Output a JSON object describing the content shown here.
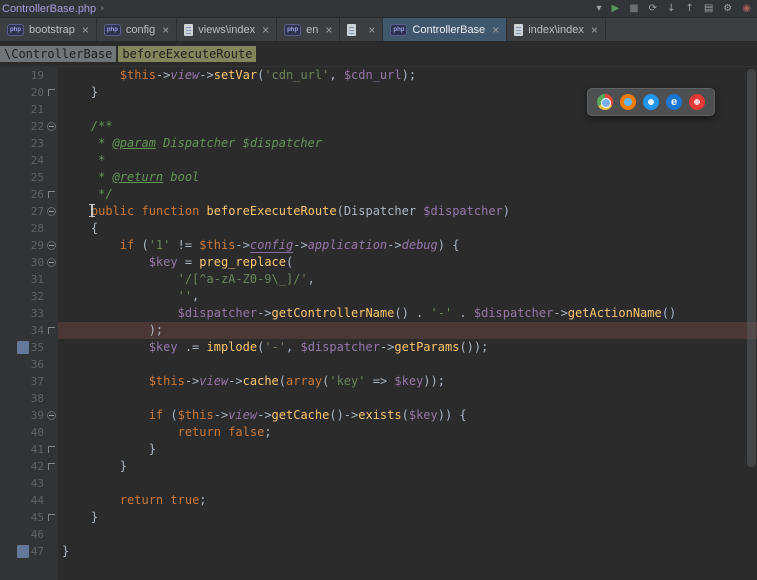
{
  "window": {
    "title": "ControllerBase.php",
    "chevron": "›"
  },
  "toolbar": {
    "icons": [
      {
        "name": "run-config-selector-icon",
        "glyph": "▾",
        "color": "#9da2a6"
      },
      {
        "name": "run-icon",
        "glyph": "▶",
        "color": "#57965c"
      },
      {
        "name": "stop-icon",
        "glyph": "■",
        "color": "#6b6f73"
      },
      {
        "name": "sync-icon",
        "glyph": "⟳",
        "color": "#9da2a6"
      },
      {
        "name": "download-icon",
        "glyph": "↓",
        "color": "#9da2a6"
      },
      {
        "name": "upload-icon",
        "glyph": "↑",
        "color": "#9da2a6"
      },
      {
        "name": "structure-icon",
        "glyph": "▤",
        "color": "#9da2a6"
      },
      {
        "name": "settings-icon",
        "glyph": "⚙",
        "color": "#9da2a6"
      },
      {
        "name": "record-icon",
        "glyph": "◉",
        "color": "#a75d5d"
      }
    ]
  },
  "ui": {
    "close_glyph": "×",
    "php_icon_text": "php"
  },
  "tabs": [
    {
      "label": "bootstrap",
      "icon": "php",
      "selected": false
    },
    {
      "label": "config",
      "icon": "php",
      "selected": false
    },
    {
      "label": "views\\index",
      "icon": "file",
      "selected": false
    },
    {
      "label": "en",
      "icon": "php",
      "selected": false
    },
    {
      "label": "",
      "icon": "file",
      "selected": false
    },
    {
      "label": "ControllerBase",
      "icon": "php",
      "selected": true
    },
    {
      "label": "index\\index",
      "icon": "file",
      "selected": false
    }
  ],
  "breadcrumb": {
    "class_name": "\\ControllerBase",
    "method_name": "beforeExecuteRoute"
  },
  "browser_popup": {
    "browsers": [
      "chrome",
      "firefox",
      "safari",
      "ie",
      "opera"
    ],
    "ie_glyph": "e"
  },
  "colors": {
    "editor_background": "#2b2b2b",
    "gutter_background": "#313335",
    "keyword": "#cc7832",
    "string": "#6a8759",
    "variable": "#9876aa",
    "function_call": "#ffc66b",
    "comment": "#629755",
    "line_number": "#606366",
    "selected_tab": "#40586d",
    "current_line_highlight": "#4a3736"
  },
  "editor": {
    "lines": [
      {
        "n": 19,
        "tokens": [
          [
            "d",
            "        "
          ],
          [
            "t",
            "$this"
          ],
          [
            "d",
            "->"
          ],
          [
            "p",
            "view"
          ],
          [
            "d",
            "->"
          ],
          [
            "f",
            "setVar"
          ],
          [
            "d",
            "("
          ],
          [
            "s",
            "'cdn_url'"
          ],
          [
            "d",
            ", "
          ],
          [
            "v",
            "$cdn_url"
          ],
          [
            "d",
            ");"
          ]
        ]
      },
      {
        "n": 20,
        "fold": "end",
        "tokens": [
          [
            "d",
            "    }"
          ]
        ]
      },
      {
        "n": 21,
        "tokens": []
      },
      {
        "n": 22,
        "fold": "open",
        "tokens": [
          [
            "c",
            "    /**"
          ]
        ]
      },
      {
        "n": 23,
        "tokens": [
          [
            "c",
            "     * "
          ],
          [
            "ct",
            "@param"
          ],
          [
            "c",
            " Dispatcher $dispatcher"
          ]
        ]
      },
      {
        "n": 24,
        "tokens": [
          [
            "c",
            "     *"
          ]
        ]
      },
      {
        "n": 25,
        "tokens": [
          [
            "c",
            "     * "
          ],
          [
            "ct",
            "@return"
          ],
          [
            "c",
            " bool"
          ]
        ]
      },
      {
        "n": 26,
        "fold": "end",
        "tokens": [
          [
            "c",
            "     */"
          ]
        ]
      },
      {
        "n": 27,
        "fold": "open",
        "tokens": [
          [
            "d",
            "    "
          ],
          [
            "caret",
            ""
          ],
          [
            "k",
            "public"
          ],
          [
            "d",
            " "
          ],
          [
            "k",
            "function"
          ],
          [
            "d",
            " "
          ],
          [
            "f",
            "beforeExecuteRoute"
          ],
          [
            "d",
            "("
          ],
          [
            "cl",
            "Dispatcher"
          ],
          [
            "d",
            " "
          ],
          [
            "v",
            "$dispatcher"
          ],
          [
            "d",
            ")"
          ]
        ]
      },
      {
        "n": 28,
        "tokens": [
          [
            "d",
            "    {"
          ]
        ]
      },
      {
        "n": 29,
        "fold": "open",
        "tokens": [
          [
            "d",
            "        "
          ],
          [
            "k",
            "if"
          ],
          [
            "d",
            " ("
          ],
          [
            "s",
            "'1'"
          ],
          [
            "d",
            " != "
          ],
          [
            "t",
            "$this"
          ],
          [
            "d",
            "->"
          ],
          [
            "pu",
            "config"
          ],
          [
            "d",
            "->"
          ],
          [
            "p",
            "application"
          ],
          [
            "d",
            "->"
          ],
          [
            "p",
            "debug"
          ],
          [
            "d",
            ") {"
          ]
        ]
      },
      {
        "n": 30,
        "fold": "open",
        "tokens": [
          [
            "d",
            "            "
          ],
          [
            "v",
            "$key"
          ],
          [
            "d",
            " = "
          ],
          [
            "f",
            "preg_replace"
          ],
          [
            "d",
            "("
          ]
        ]
      },
      {
        "n": 31,
        "tokens": [
          [
            "d",
            "                "
          ],
          [
            "s",
            "'/[^a-zA-Z0-9\\_]/'"
          ],
          [
            "d",
            ","
          ]
        ]
      },
      {
        "n": 32,
        "tokens": [
          [
            "d",
            "                "
          ],
          [
            "s",
            "''"
          ],
          [
            "d",
            ","
          ]
        ]
      },
      {
        "n": 33,
        "tokens": [
          [
            "d",
            "                "
          ],
          [
            "v",
            "$dispatcher"
          ],
          [
            "d",
            "->"
          ],
          [
            "f",
            "getControllerName"
          ],
          [
            "d",
            "() . "
          ],
          [
            "s",
            "'-'"
          ],
          [
            "d",
            " . "
          ],
          [
            "v",
            "$dispatcher"
          ],
          [
            "d",
            "->"
          ],
          [
            "f",
            "getActionName"
          ],
          [
            "d",
            "()"
          ]
        ]
      },
      {
        "n": 34,
        "fold": "end",
        "hl": true,
        "tokens": [
          [
            "d",
            "            );"
          ]
        ]
      },
      {
        "n": 35,
        "mark": true,
        "tokens": [
          [
            "d",
            "            "
          ],
          [
            "v",
            "$key"
          ],
          [
            "d",
            " .= "
          ],
          [
            "f",
            "implode"
          ],
          [
            "d",
            "("
          ],
          [
            "s",
            "'-'"
          ],
          [
            "d",
            ", "
          ],
          [
            "v",
            "$dispatcher"
          ],
          [
            "d",
            "->"
          ],
          [
            "f",
            "getParams"
          ],
          [
            "d",
            "());"
          ]
        ]
      },
      {
        "n": 36,
        "tokens": []
      },
      {
        "n": 37,
        "tokens": [
          [
            "d",
            "            "
          ],
          [
            "t",
            "$this"
          ],
          [
            "d",
            "->"
          ],
          [
            "p",
            "view"
          ],
          [
            "d",
            "->"
          ],
          [
            "f",
            "cache"
          ],
          [
            "d",
            "("
          ],
          [
            "k",
            "array"
          ],
          [
            "d",
            "("
          ],
          [
            "s",
            "'key'"
          ],
          [
            "d",
            " => "
          ],
          [
            "v",
            "$key"
          ],
          [
            "d",
            "));"
          ]
        ]
      },
      {
        "n": 38,
        "tokens": []
      },
      {
        "n": 39,
        "fold": "open",
        "tokens": [
          [
            "d",
            "            "
          ],
          [
            "k",
            "if"
          ],
          [
            "d",
            " ("
          ],
          [
            "t",
            "$this"
          ],
          [
            "d",
            "->"
          ],
          [
            "p",
            "view"
          ],
          [
            "d",
            "->"
          ],
          [
            "f",
            "getCache"
          ],
          [
            "d",
            "()->"
          ],
          [
            "f",
            "exists"
          ],
          [
            "d",
            "("
          ],
          [
            "v",
            "$key"
          ],
          [
            "d",
            ")) {"
          ]
        ]
      },
      {
        "n": 40,
        "tokens": [
          [
            "d",
            "                "
          ],
          [
            "k",
            "return"
          ],
          [
            "d",
            " "
          ],
          [
            "k",
            "false"
          ],
          [
            "d",
            ";"
          ]
        ]
      },
      {
        "n": 41,
        "fold": "end",
        "tokens": [
          [
            "d",
            "            }"
          ]
        ]
      },
      {
        "n": 42,
        "fold": "end",
        "tokens": [
          [
            "d",
            "        }"
          ]
        ]
      },
      {
        "n": 43,
        "tokens": []
      },
      {
        "n": 44,
        "tokens": [
          [
            "d",
            "        "
          ],
          [
            "k",
            "return"
          ],
          [
            "d",
            " "
          ],
          [
            "k",
            "true"
          ],
          [
            "d",
            ";"
          ]
        ]
      },
      {
        "n": 45,
        "fold": "end",
        "tokens": [
          [
            "d",
            "    }"
          ]
        ]
      },
      {
        "n": 46,
        "tokens": []
      },
      {
        "n": 47,
        "mark": true,
        "tokens": [
          [
            "d",
            "}"
          ]
        ]
      }
    ]
  }
}
